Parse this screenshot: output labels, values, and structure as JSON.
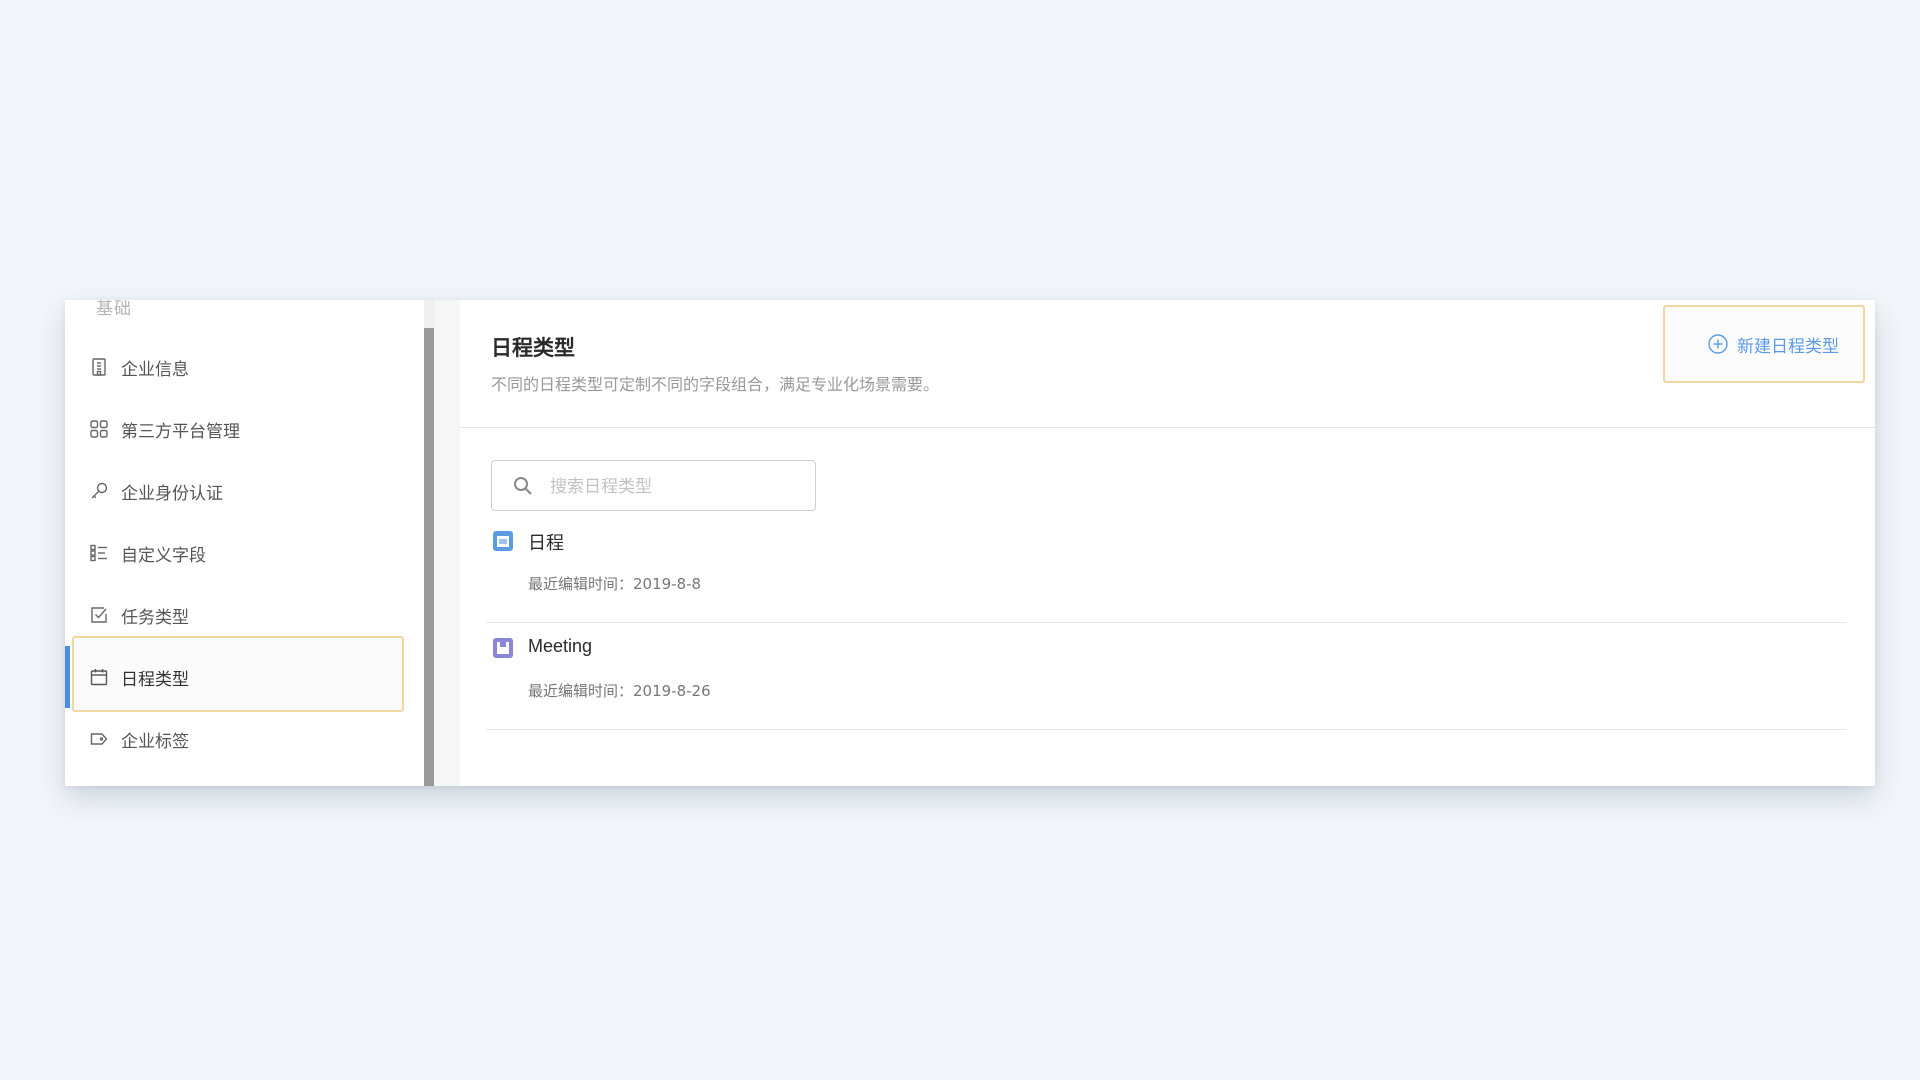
{
  "sidebar": {
    "section_label": "基础",
    "items": [
      {
        "label": "企业信息",
        "icon": "building-icon"
      },
      {
        "label": "第三方平台管理",
        "icon": "grid-apps-icon"
      },
      {
        "label": "企业身份认证",
        "icon": "key-icon"
      },
      {
        "label": "自定义字段",
        "icon": "field-list-icon"
      },
      {
        "label": "任务类型",
        "icon": "task-check-icon"
      },
      {
        "label": "日程类型",
        "icon": "calendar-icon",
        "active": true
      },
      {
        "label": "企业标签",
        "icon": "tag-icon"
      }
    ]
  },
  "main": {
    "title": "日程类型",
    "description": "不同的日程类型可定制不同的字段组合，满足专业化场景需要。",
    "new_button_label": "新建日程类型",
    "search": {
      "placeholder": "搜索日程类型",
      "value": ""
    },
    "list": [
      {
        "name": "日程",
        "meta": "最近编辑时间：2019-8-8",
        "color": "#5b9be0"
      },
      {
        "name": "Meeting",
        "meta": "最近编辑时间：2019-8-26",
        "color": "#8b85d6"
      }
    ]
  },
  "colors": {
    "accent": "#4a8fdc",
    "link": "#5a9ae6",
    "highlight_border": "#f3d7a3",
    "background": "#f2f6fa"
  }
}
